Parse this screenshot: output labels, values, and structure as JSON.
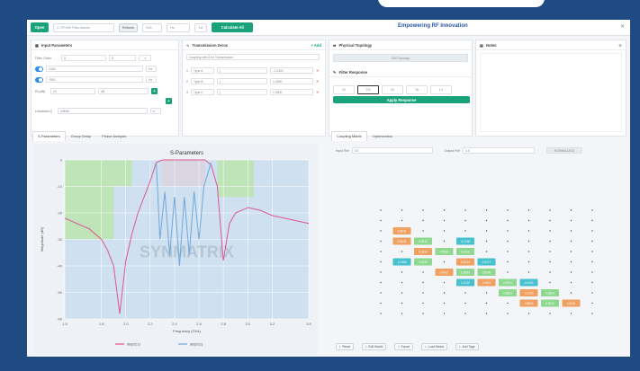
{
  "toolbar": {
    "open_label": "Open",
    "file_placeholder": "C:\\TF\\HB Filter.dcsxfx",
    "refresh_label": "Refresh",
    "dim_value": "N/A",
    "unit_value": "Hz",
    "tol_value": "Tol",
    "calc_label": "Calculate All"
  },
  "app_title": "Empowering RF Innovation",
  "input_panel": {
    "title": "Input Parameters",
    "order_label": "Filter Order",
    "order_value": "8",
    "order_value2": "8",
    "freq1_value": "2400",
    "freq2_value": "2500",
    "rl_label": "RL(dB)",
    "rl_value": "20",
    "unit_value": "dB",
    "qu_label": "Unloaded Q",
    "qu_value": "Infinite"
  },
  "tz_panel": {
    "title": "Transmission Zeros",
    "add_label": "Add",
    "hint": "Coupling with 8 for Transmission",
    "rows": [
      {
        "idx": "1",
        "label": "Type A",
        "val": "j",
        "num": "-1.2400"
      },
      {
        "idx": "2",
        "label": "Type B",
        "val": "j",
        "num": "1.3000"
      },
      {
        "idx": "3",
        "label": "Type C",
        "val": "j",
        "num": "1.5500"
      }
    ]
  },
  "topology_panel": {
    "title": "Physical Topology",
    "button": "Edit Topology",
    "resp_title": "Filter Response",
    "resp_values": [
      "20",
      "3.5",
      "40",
      "18",
      "1.2"
    ],
    "apply_label": "Apply Response"
  },
  "notes_panel": {
    "title": "Notes"
  },
  "left_tabs": [
    "S-Parameters",
    "Group Delay",
    "Phase Analysis"
  ],
  "right_tabs": [
    "Coupling Matrix",
    "Optimization"
  ],
  "matrix_controls": {
    "field1_label": "Input Ref",
    "field1_value": "0.5",
    "field2_label": "Output Ref",
    "field2_value": "0.5",
    "normalize_label": "NORMALIZED"
  },
  "bottom_buttons": [
    "Reset",
    "Edit Matrix",
    "Export",
    "Load Matrix",
    "Add Tags"
  ],
  "chart_data": {
    "type": "line",
    "title": "S-Parameters",
    "xlabel": "Frequency (GHz)",
    "ylabel": "Magnitude (dB)",
    "xlim": [
      1.5,
      3.5
    ],
    "ylim": [
      -60,
      0
    ],
    "x_ticks": [
      "1.5",
      "1.8",
      "2.0",
      "2.2",
      "2.4",
      "2.6",
      "2.8",
      "3.0",
      "3.2",
      "3.5"
    ],
    "y_ticks": [
      "0",
      "-10",
      "-20",
      "-30",
      "-40",
      "-50",
      "-60"
    ],
    "grid": true,
    "legend_position": "bottom",
    "watermark": "SYNMATRIX",
    "series": [
      {
        "name": "dB(S21)",
        "color": "#e05590",
        "x": [
          1.5,
          1.7,
          1.8,
          1.85,
          1.9,
          1.95,
          2.0,
          2.05,
          2.1,
          2.2,
          2.25,
          2.3,
          2.35,
          2.4,
          2.45,
          2.5,
          2.55,
          2.6,
          2.65,
          2.7,
          2.75,
          2.8,
          2.85,
          2.9,
          3.0,
          3.1,
          3.2,
          3.3,
          3.5
        ],
        "y": [
          -22,
          -26,
          -30,
          -34,
          -40,
          -58,
          -38,
          -28,
          -20,
          -8,
          -1,
          0,
          0,
          0,
          0,
          0,
          0,
          0,
          0,
          -2,
          -10,
          -38,
          -24,
          -20,
          -18,
          -19,
          -21,
          -22,
          -24
        ]
      },
      {
        "name": "dB(S11)",
        "color": "#6fa8dc",
        "x": [
          2.25,
          2.28,
          2.32,
          2.36,
          2.4,
          2.44,
          2.48,
          2.52,
          2.56,
          2.6,
          2.64,
          2.68,
          2.7
        ],
        "y": [
          -1,
          -30,
          -12,
          -36,
          -14,
          -40,
          -14,
          -36,
          -12,
          -30,
          -10,
          -4,
          -1
        ]
      }
    ],
    "masks": [
      {
        "x": [
          1.5,
          2.05
        ],
        "y": [
          -10,
          0
        ]
      },
      {
        "x": [
          1.5,
          1.9
        ],
        "y": [
          -30,
          -10
        ]
      },
      {
        "x": [
          2.75,
          3.05
        ],
        "y": [
          -14,
          0
        ]
      },
      {
        "x": [
          2.3,
          2.65
        ],
        "y": [
          -10,
          0
        ]
      }
    ]
  },
  "matrix": {
    "size": 11,
    "highlights": [
      {
        "r": 2,
        "c": 1,
        "color": "#f0a060",
        "label": "0.8931"
      },
      {
        "r": 3,
        "c": 1,
        "color": "#f0a060",
        "label": "0.0632"
      },
      {
        "r": 3,
        "c": 2,
        "color": "#8fd88f",
        "label": "0.5912"
      },
      {
        "r": 3,
        "c": 4,
        "color": "#45c1cf",
        "label": "-0.2180"
      },
      {
        "r": 4,
        "c": 2,
        "color": "#f0a060",
        "label": "0.3810"
      },
      {
        "r": 4,
        "c": 3,
        "color": "#8fd88f",
        "label": "0.5541"
      },
      {
        "r": 4,
        "c": 4,
        "color": "#8fd88f",
        "label": "0.4112"
      },
      {
        "r": 5,
        "c": 1,
        "color": "#45c1cf",
        "label": "-0.1550"
      },
      {
        "r": 5,
        "c": 2,
        "color": "#8fd88f",
        "label": "0.6023"
      },
      {
        "r": 5,
        "c": 4,
        "color": "#f0a060",
        "label": "0.5124"
      },
      {
        "r": 5,
        "c": 5,
        "color": "#45c1cf",
        "label": "0.0217"
      },
      {
        "r": 6,
        "c": 3,
        "color": "#f0a060",
        "label": "0.0411"
      },
      {
        "r": 6,
        "c": 4,
        "color": "#8fd88f",
        "label": "0.5630"
      },
      {
        "r": 6,
        "c": 5,
        "color": "#8fd88f",
        "label": "0.5240"
      },
      {
        "r": 7,
        "c": 4,
        "color": "#45c1cf",
        "label": "0.1020"
      },
      {
        "r": 7,
        "c": 5,
        "color": "#f0a060",
        "label": "0.4921"
      },
      {
        "r": 7,
        "c": 6,
        "color": "#8fd88f",
        "label": "0.5701"
      },
      {
        "r": 7,
        "c": 7,
        "color": "#45c1cf",
        "label": "0.0340"
      },
      {
        "r": 8,
        "c": 6,
        "color": "#8fd88f",
        "label": "0.5803"
      },
      {
        "r": 8,
        "c": 7,
        "color": "#f0a060",
        "label": "0.1720"
      },
      {
        "r": 8,
        "c": 8,
        "color": "#8fd88f",
        "label": "0.6124"
      },
      {
        "r": 9,
        "c": 7,
        "color": "#f0a060",
        "label": "0.8820"
      },
      {
        "r": 9,
        "c": 8,
        "color": "#8fd88f",
        "label": "0.9012"
      },
      {
        "r": 9,
        "c": 9,
        "color": "#f0a060",
        "label": "0.0021"
      }
    ]
  }
}
